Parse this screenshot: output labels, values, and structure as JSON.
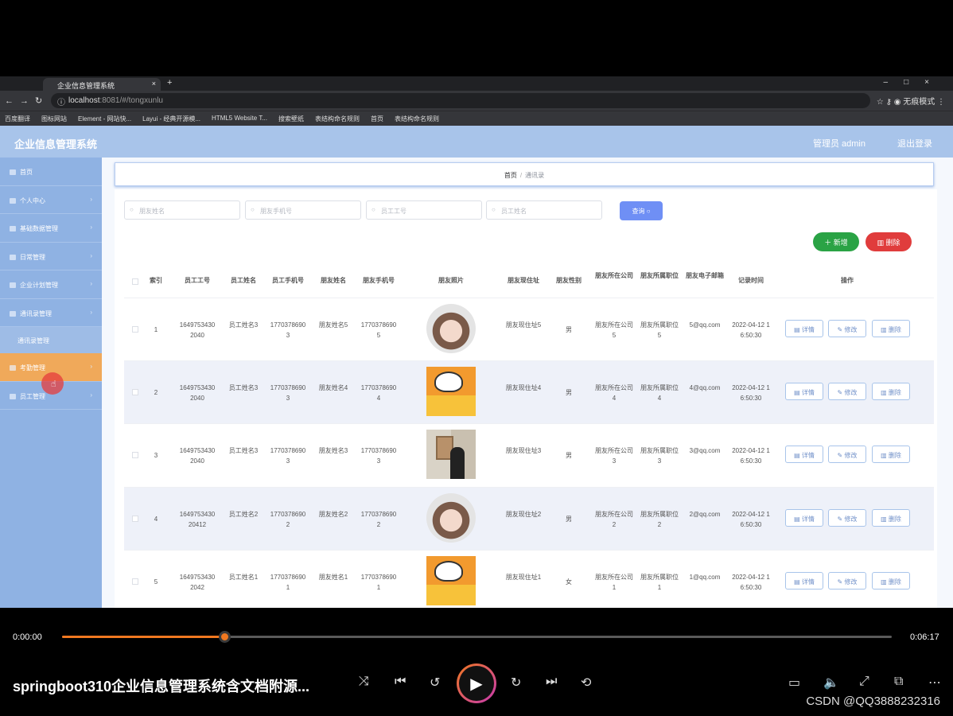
{
  "browser": {
    "tab_title": "企业信息管理系统",
    "url_host": "localhost",
    "url_rest": ":8081/#/tongxunlu",
    "incognito_label": "无痕模式",
    "bookmarks": [
      "百度翻译",
      "图标网站",
      "Element - 网站快...",
      "Layui - 经典开源模...",
      "HTML5 Website T...",
      "搜索壁纸",
      "表结构命名规则",
      "首页",
      "表结构命名规则"
    ]
  },
  "header": {
    "title": "企业信息管理系统",
    "user": "管理员 admin",
    "logout": "退出登录"
  },
  "sidebar": {
    "items": [
      {
        "label": "首页"
      },
      {
        "label": "个人中心"
      },
      {
        "label": "基础数据管理"
      },
      {
        "label": "日常管理"
      },
      {
        "label": "企业计划管理"
      },
      {
        "label": "通讯录管理"
      }
    ],
    "sub_item": "通讯录管理",
    "items_after": [
      {
        "label": "考勤管理"
      },
      {
        "label": "员工管理"
      }
    ]
  },
  "breadcrumb": {
    "home": "首页",
    "sep": "/",
    "current": "通讯录"
  },
  "search": {
    "friend_name_placeholder": "朋友姓名",
    "friend_phone_placeholder": "朋友手机号",
    "emp_no_placeholder": "员工工号",
    "emp_name_placeholder": "员工姓名",
    "query_label": "查询"
  },
  "actions": {
    "add_label": "新增",
    "delete_label": "删除"
  },
  "table": {
    "headers": [
      "索引",
      "员工工号",
      "员工姓名",
      "员工手机号",
      "朋友姓名",
      "朋友手机号",
      "朋友照片",
      "朋友现住址",
      "朋友性别",
      "朋友所在公司",
      "朋友所属职位",
      "朋友电子邮箱",
      "记录时间",
      "操作"
    ],
    "rows": [
      {
        "idx": "1",
        "emp_no": "16497534302040",
        "emp_name": "员工姓名3",
        "emp_phone": "17703786903",
        "friend_name": "朋友姓名5",
        "friend_phone": "17703786905",
        "photo": "girl",
        "addr": "朋友现住址5",
        "sex": "男",
        "company": "朋友所在公司5",
        "position": "朋友所属职位5",
        "email": "5@qq.com",
        "time": "2022-04-12 16:50:30"
      },
      {
        "idx": "2",
        "emp_no": "16497534302040",
        "emp_name": "员工姓名3",
        "emp_phone": "17703786903",
        "friend_name": "朋友姓名4",
        "friend_phone": "17703786904",
        "photo": "cartoon",
        "addr": "朋友现住址4",
        "sex": "男",
        "company": "朋友所在公司4",
        "position": "朋友所属职位4",
        "email": "4@qq.com",
        "time": "2022-04-12 16:50:30"
      },
      {
        "idx": "3",
        "emp_no": "16497534302040",
        "emp_name": "员工姓名3",
        "emp_phone": "17703786903",
        "friend_name": "朋友姓名3",
        "friend_phone": "17703786903",
        "photo": "photo",
        "addr": "朋友现住址3",
        "sex": "男",
        "company": "朋友所在公司3",
        "position": "朋友所属职位3",
        "email": "3@qq.com",
        "time": "2022-04-12 16:50:30"
      },
      {
        "idx": "4",
        "emp_no": "164975343020412",
        "emp_name": "员工姓名2",
        "emp_phone": "17703786902",
        "friend_name": "朋友姓名2",
        "friend_phone": "17703786902",
        "photo": "girl",
        "addr": "朋友现住址2",
        "sex": "男",
        "company": "朋友所在公司2",
        "position": "朋友所属职位2",
        "email": "2@qq.com",
        "time": "2022-04-12 16:50:30"
      },
      {
        "idx": "5",
        "emp_no": "16497534302042",
        "emp_name": "员工姓名1",
        "emp_phone": "17703786901",
        "friend_name": "朋友姓名1",
        "friend_phone": "17703786901",
        "photo": "cartoon",
        "addr": "朋友现住址1",
        "sex": "女",
        "company": "朋友所在公司1",
        "position": "朋友所属职位1",
        "email": "1@qq.com",
        "time": "2022-04-12 16:50:30"
      }
    ],
    "op_detail": "详情",
    "op_edit": "修改",
    "op_delete": "删除"
  },
  "player": {
    "current_time": "0:00:00",
    "total_time": "0:06:17",
    "progress": 0.196,
    "video_title": "springboot310企业信息管理系统含文档附源...",
    "watermark": "CSDN @QQ3888232316"
  },
  "colors": {
    "header": "#a8c4ea",
    "sidebar": "#8fb2e3",
    "active": "#f0a95a",
    "query": "#6f8ff5",
    "add": "#2aa345",
    "delete": "#e03c3c",
    "progress": "#f07820"
  }
}
